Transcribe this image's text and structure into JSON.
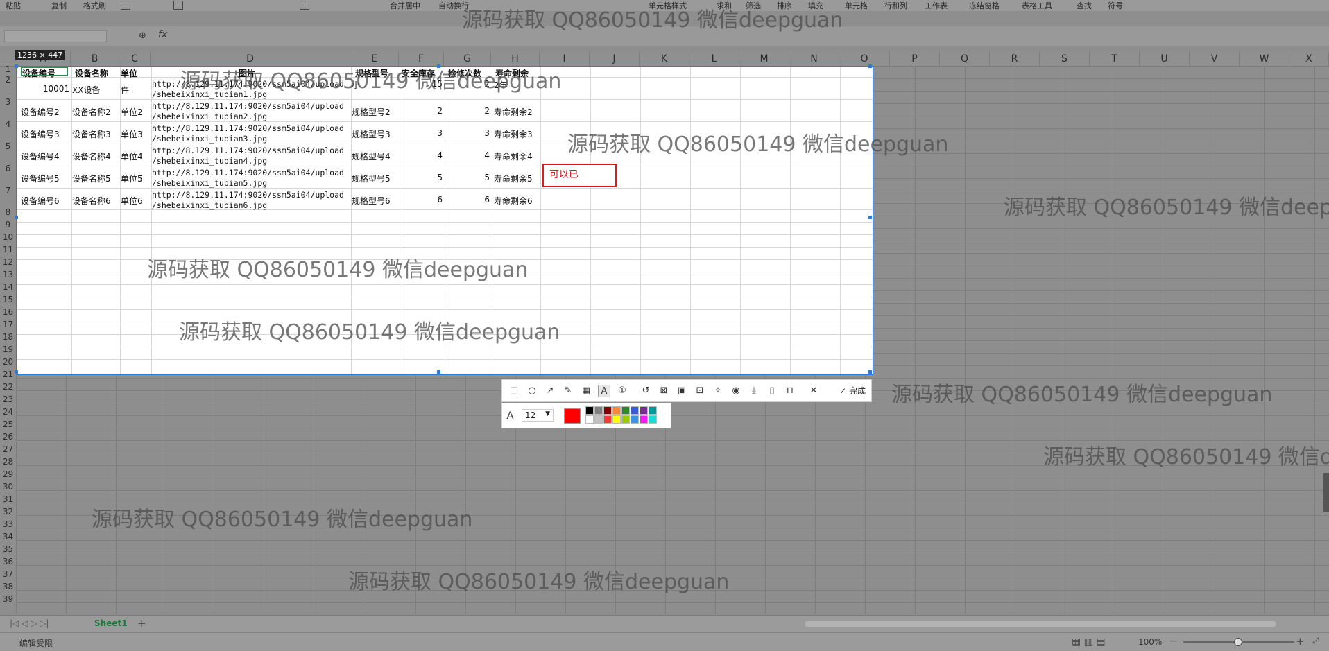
{
  "ribbon": {
    "items": [
      "粘贴",
      "复制",
      "格式刷",
      "合并居中",
      "自动换行",
      "单元格样式",
      "求和",
      "筛选",
      "排序",
      "填充",
      "单元格",
      "行和列",
      "工作表",
      "冻结窗格",
      "表格工具",
      "查找",
      "符号"
    ]
  },
  "formula_bar": {
    "fx": "fx",
    "value": ""
  },
  "columns": [
    "A",
    "B",
    "C",
    "D",
    "E",
    "F",
    "G",
    "H",
    "I",
    "J",
    "K",
    "L",
    "M",
    "N",
    "O",
    "P",
    "Q",
    "R",
    "S",
    "T",
    "U",
    "V",
    "W",
    "X"
  ],
  "rows": [
    "1",
    "2",
    "3",
    "4",
    "5",
    "6",
    "7",
    "8",
    "9",
    "10",
    "11",
    "12",
    "13",
    "14",
    "15",
    "16",
    "17",
    "18",
    "19",
    "20",
    "21",
    "22",
    "23",
    "24",
    "25",
    "26",
    "27",
    "28",
    "29",
    "30",
    "31",
    "32",
    "33",
    "34",
    "35",
    "36",
    "37",
    "38",
    "39"
  ],
  "screenshot": {
    "size_label": "1236 × 447"
  },
  "table": {
    "headers": [
      "设备编号",
      "设备名称",
      "单位",
      "图片",
      "规格型号",
      "安全库存",
      "检修次数",
      "寿命剩余"
    ],
    "rows": [
      [
        "10001",
        "XX设备",
        "件",
        "http://8.129.11.174:9020/ssm5ai04/upload",
        "/shebeixinxi_tupian1.jpg",
        "小",
        "15",
        "2",
        "2年"
      ],
      [
        "设备编号2",
        "设备名称2",
        "单位2",
        "http://8.129.11.174:9020/ssm5ai04/upload",
        "/shebeixinxi_tupian2.jpg",
        "规格型号2",
        "2",
        "2",
        "寿命剩余2"
      ],
      [
        "设备编号3",
        "设备名称3",
        "单位3",
        "http://8.129.11.174:9020/ssm5ai04/upload",
        "/shebeixinxi_tupian3.jpg",
        "规格型号3",
        "3",
        "3",
        "寿命剩余3"
      ],
      [
        "设备编号4",
        "设备名称4",
        "单位4",
        "http://8.129.11.174:9020/ssm5ai04/upload",
        "/shebeixinxi_tupian4.jpg",
        "规格型号4",
        "4",
        "4",
        "寿命剩余4"
      ],
      [
        "设备编号5",
        "设备名称5",
        "单位5",
        "http://8.129.11.174:9020/ssm5ai04/upload",
        "/shebeixinxi_tupian5.jpg",
        "规格型号5",
        "5",
        "5",
        "寿命剩余5"
      ],
      [
        "设备编号6",
        "设备名称6",
        "单位6",
        "http://8.129.11.174:9020/ssm5ai04/upload",
        "/shebeixinxi_tupian6.jpg",
        "规格型号6",
        "6",
        "6",
        "寿命剩余6"
      ]
    ]
  },
  "annotation": {
    "text": "可以已",
    "color": "#e0191b"
  },
  "toolbar": {
    "finish_label": "完成",
    "font_size": "12",
    "active_color": "#ff0000"
  },
  "palette": [
    "#000000",
    "#808080",
    "#800000",
    "#f7883a",
    "#308430",
    "#385ad3",
    "#772e8e",
    "#009999",
    "#ffffff",
    "#c0c0c0",
    "#fb3838",
    "#ffff00",
    "#99cc00",
    "#3894e4",
    "#f31bf3",
    "#16dcdc"
  ],
  "watermark_text": "源码获取 QQ86050149 微信deepguan",
  "sheet": {
    "tab": "Sheet1"
  },
  "status": {
    "left": "编辑受限",
    "zoom": "100%"
  }
}
